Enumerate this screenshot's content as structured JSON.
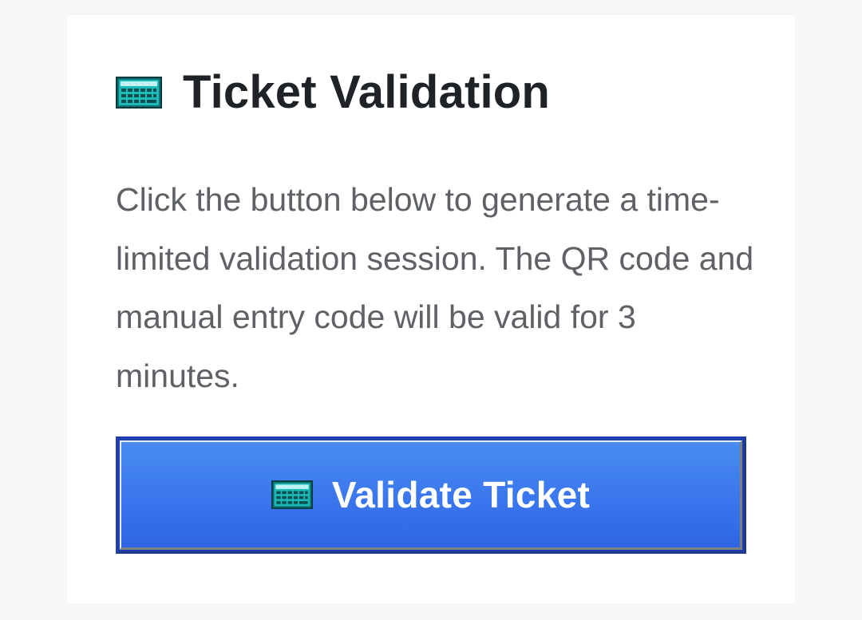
{
  "card": {
    "title": "Ticket Validation",
    "title_icon": "calculator-icon",
    "description": "Click the button below to generate a time-limited validation session. The QR code and manual entry code will be valid for 3 minutes."
  },
  "button": {
    "label": "Validate Ticket",
    "icon": "calculator-icon"
  },
  "colors": {
    "background": "#f6f7f9",
    "card": "#ffffff",
    "title": "#1f2226",
    "text": "#5e6166",
    "button": "#3b78ee",
    "button_border": "#1e40af",
    "icon": "#18b7b5"
  }
}
